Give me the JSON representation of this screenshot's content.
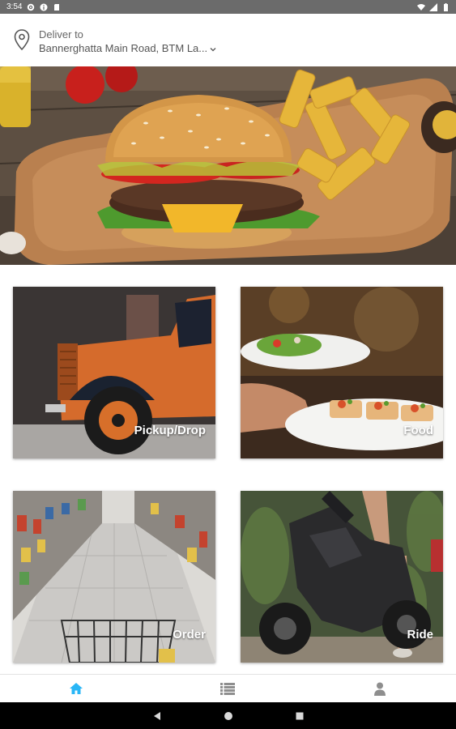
{
  "status_bar": {
    "time": "3:54",
    "left_icons": [
      "settings-icon",
      "info-icon",
      "sd-card-icon"
    ],
    "right_icons": [
      "wifi-icon",
      "signal-icon",
      "battery-icon"
    ]
  },
  "header": {
    "deliver_label": "Deliver to",
    "address": "Bannerghatta Main Road, BTM La...",
    "icon": "location-pin-icon",
    "dropdown_icon": "chevron-down-icon"
  },
  "hero": {
    "image": "burger-and-fries-banner"
  },
  "services": [
    {
      "id": "pickup",
      "label": "Pickup/Drop",
      "image": "orange-truck"
    },
    {
      "id": "food",
      "label": "Food",
      "image": "plated-food"
    },
    {
      "id": "order",
      "label": "Order",
      "image": "supermarket-aisle"
    },
    {
      "id": "ride",
      "label": "Ride",
      "image": "scooter-rider"
    }
  ],
  "bottom_nav": [
    {
      "icon": "home-icon",
      "active": true
    },
    {
      "icon": "list-icon",
      "active": false
    },
    {
      "icon": "person-icon",
      "active": false
    }
  ],
  "colors": {
    "accent": "#29b6f6",
    "nav_inactive": "#8e8e8e",
    "status_bar": "#6b6b6b",
    "label_text": "#ffffff"
  }
}
